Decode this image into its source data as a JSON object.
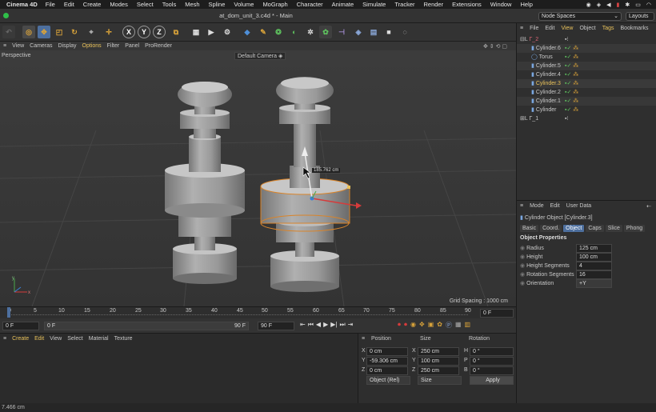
{
  "menubar": {
    "app": "Cinema 4D",
    "items": [
      "File",
      "Edit",
      "Create",
      "Modes",
      "Select",
      "Tools",
      "Mesh",
      "Spline",
      "Volume",
      "MoGraph",
      "Character",
      "Animate",
      "Simulate",
      "Tracker",
      "Render",
      "Extensions",
      "Window",
      "Help"
    ]
  },
  "window": {
    "title": "at_dom_unit_3.c4d * - Main",
    "node_spaces": "Node Spaces",
    "layouts": "Layouts"
  },
  "toolbar": {
    "axis_x": "X",
    "axis_y": "Y",
    "axis_z": "Z"
  },
  "viewport_menu": [
    "View",
    "Cameras",
    "Display",
    "Options",
    "Filter",
    "Panel",
    "ProRender"
  ],
  "viewport": {
    "label": "Perspective",
    "camera": "Default Camera",
    "measure": "185.762 cm",
    "grid_spacing": "Grid Spacing : 1000 cm"
  },
  "timeline": {
    "ticks": [
      "0",
      "5",
      "10",
      "15",
      "20",
      "25",
      "30",
      "35",
      "40",
      "45",
      "50",
      "55",
      "60",
      "65",
      "70",
      "75",
      "80",
      "85",
      "90"
    ],
    "frame_field": "0 F"
  },
  "transport": {
    "start": "0 F",
    "current": "0 F",
    "end": "90 F",
    "max": "90 F"
  },
  "material_menu": [
    "Create",
    "Edit",
    "View",
    "Select",
    "Material",
    "Texture"
  ],
  "coords": {
    "headers": [
      "Position",
      "Size",
      "Rotation"
    ],
    "rows": [
      {
        "axis": "X",
        "pos": "0 cm",
        "saxis": "X",
        "size": "250 cm",
        "raxis": "H",
        "rot": "0 °"
      },
      {
        "axis": "Y",
        "pos": "-59.306 cm",
        "saxis": "Y",
        "size": "100 cm",
        "raxis": "P",
        "rot": "0 °"
      },
      {
        "axis": "Z",
        "pos": "0 cm",
        "saxis": "Z",
        "size": "250 cm",
        "raxis": "B",
        "rot": "0 °"
      }
    ],
    "mode": "Object (Rel)",
    "size_mode": "Size",
    "apply": "Apply"
  },
  "status": "7.466 cm",
  "object_manager": {
    "menu": [
      "File",
      "Edit",
      "View",
      "Object",
      "Tags",
      "Bookmarks"
    ],
    "objects": [
      {
        "name": "Γ_2",
        "indent": 0
      },
      {
        "name": "Cylinder.6",
        "indent": 1
      },
      {
        "name": "Torus",
        "indent": 1
      },
      {
        "name": "Cylinder.5",
        "indent": 1
      },
      {
        "name": "Cylinder.4",
        "indent": 1
      },
      {
        "name": "Cylinder.3",
        "indent": 1,
        "selected": true
      },
      {
        "name": "Cylinder.2",
        "indent": 1
      },
      {
        "name": "Cylinder.1",
        "indent": 1
      },
      {
        "name": "Cylinder",
        "indent": 1
      },
      {
        "name": "Γ_1",
        "indent": 0
      }
    ]
  },
  "attributes": {
    "menu": [
      "Mode",
      "Edit",
      "User Data"
    ],
    "title": "Cylinder Object [Cylinder.3]",
    "tabs": [
      "Basic",
      "Coord.",
      "Object",
      "Caps",
      "Slice",
      "Phong"
    ],
    "active_tab": "Object",
    "section": "Object Properties",
    "props": [
      {
        "label": "Radius",
        "value": "125 cm"
      },
      {
        "label": "Height",
        "value": "100 cm"
      },
      {
        "label": "Height Segments",
        "value": "4"
      },
      {
        "label": "Rotation Segments",
        "value": "16"
      },
      {
        "label": "Orientation",
        "value": "+Y"
      }
    ]
  }
}
